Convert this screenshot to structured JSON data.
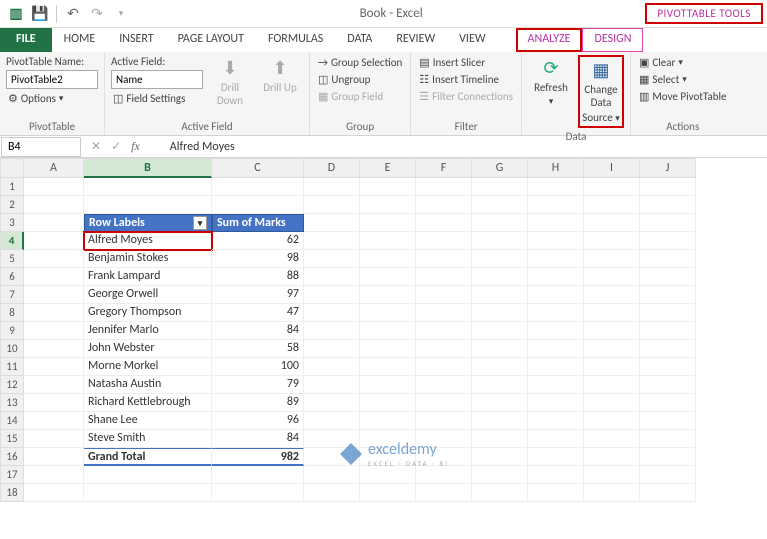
{
  "title": "Book - Excel",
  "context_tools": "PIVOTTABLE TOOLS",
  "tabs": {
    "file": "FILE",
    "home": "HOME",
    "insert": "INSERT",
    "pagelayout": "PAGE LAYOUT",
    "formulas": "FORMULAS",
    "data": "DATA",
    "review": "REVIEW",
    "view": "VIEW",
    "analyze": "ANALYZE",
    "design": "DESIGN"
  },
  "ribbon": {
    "ptname_lbl": "PivotTable Name:",
    "ptname_val": "PivotTable2",
    "options": "Options",
    "pt_group": "PivotTable",
    "af_lbl": "Active Field:",
    "af_val": "Name",
    "fs": "Field Settings",
    "af_group": "Active Field",
    "drilldown": "Drill Down",
    "drillup": "Drill Up",
    "gs": "Group Selection",
    "ug": "Ungroup",
    "gf": "Group Field",
    "g_group": "Group",
    "is": "Insert Slicer",
    "it": "Insert Timeline",
    "fc": "Filter Connections",
    "f_group": "Filter",
    "refresh": "Refresh",
    "cds1": "Change Data",
    "cds2": "Source",
    "d_group": "Data",
    "clear": "Clear",
    "select": "Select",
    "move": "Move PivotTable",
    "a_group": "Actions"
  },
  "namebox": "B4",
  "fx_value": "Alfred Moyes",
  "columns": [
    "A",
    "B",
    "C",
    "D",
    "E",
    "F",
    "G",
    "H",
    "I",
    "J"
  ],
  "pivot": {
    "hdr_labels": "Row Labels",
    "hdr_sum": "Sum of Marks",
    "rows": [
      {
        "n": "Alfred Moyes",
        "v": 62
      },
      {
        "n": "Benjamin Stokes",
        "v": 98
      },
      {
        "n": "Frank Lampard",
        "v": 88
      },
      {
        "n": "George Orwell",
        "v": 97
      },
      {
        "n": "Gregory Thompson",
        "v": 47
      },
      {
        "n": "Jennifer Marlo",
        "v": 84
      },
      {
        "n": "John Webster",
        "v": 58
      },
      {
        "n": "Morne Morkel",
        "v": 100
      },
      {
        "n": "Natasha Austin",
        "v": 79
      },
      {
        "n": "Richard Kettlebrough",
        "v": 89
      },
      {
        "n": "Shane Lee",
        "v": 96
      },
      {
        "n": "Steve Smith",
        "v": 84
      }
    ],
    "grand_lbl": "Grand Total",
    "grand_val": 982
  },
  "watermark": {
    "brand": "exceldemy",
    "tag": "EXCEL · DATA · BI"
  },
  "chart_data": {
    "type": "table",
    "title": "PivotTable Sum of Marks by Row Labels",
    "columns": [
      "Row Labels",
      "Sum of Marks"
    ],
    "rows": [
      [
        "Alfred Moyes",
        62
      ],
      [
        "Benjamin Stokes",
        98
      ],
      [
        "Frank Lampard",
        88
      ],
      [
        "George Orwell",
        97
      ],
      [
        "Gregory Thompson",
        47
      ],
      [
        "Jennifer Marlo",
        84
      ],
      [
        "John Webster",
        58
      ],
      [
        "Morne Morkel",
        100
      ],
      [
        "Natasha Austin",
        79
      ],
      [
        "Richard Kettlebrough",
        89
      ],
      [
        "Shane Lee",
        96
      ],
      [
        "Steve Smith",
        84
      ]
    ],
    "total": [
      "Grand Total",
      982
    ]
  }
}
